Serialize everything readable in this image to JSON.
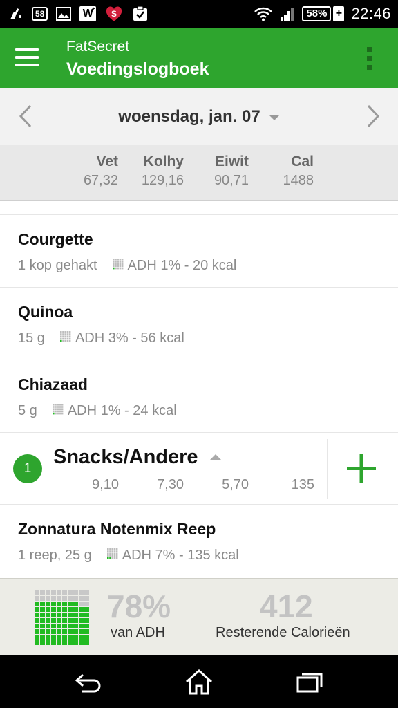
{
  "status_bar": {
    "notification_58": "58",
    "w_icon_text": "W",
    "battery_percent": "58%",
    "charging_symbol": "+",
    "time": "22:46"
  },
  "app_bar": {
    "app_name": "FatSecret",
    "title": "Voedingslogboek"
  },
  "date_nav": {
    "date": "woensdag, jan. 07"
  },
  "totals": {
    "columns": [
      {
        "label": "Vet",
        "value": "67,32"
      },
      {
        "label": "Kolhy",
        "value": "129,16"
      },
      {
        "label": "Eiwit",
        "value": "90,71"
      },
      {
        "label": "Cal",
        "value": "1488"
      }
    ]
  },
  "entries": [
    {
      "name": "Courgette",
      "amount": "1 kop gehakt",
      "rdi": "ADH 1% - 20 kcal"
    },
    {
      "name": "Quinoa",
      "amount": "15 g",
      "rdi": "ADH 3% - 56 kcal"
    },
    {
      "name": "Chiazaad",
      "amount": "5 g",
      "rdi": "ADH 1% - 24 kcal"
    }
  ],
  "meal": {
    "count": "1",
    "name": "Snacks/Andere",
    "values": [
      "9,10",
      "7,30",
      "5,70",
      "135"
    ]
  },
  "meal_entries": [
    {
      "name": "Zonnatura Notenmix Reep",
      "amount": "1 reep, 25 g",
      "rdi": "ADH 7% - 135 kcal"
    }
  ],
  "summary": {
    "rdi_percent": "78%",
    "rdi_label": "van ADH",
    "rdi_fraction": 0.78,
    "remaining_calories": "412",
    "remaining_label": "Resterende Calorieën"
  },
  "colors": {
    "brand_green": "#2ea52e",
    "grid_filled": "#22bb22",
    "grid_empty": "#c8c8c8"
  },
  "icons": {
    "menu": "hamburger-icon",
    "overflow": "overflow-menu-icon",
    "prev": "chevron-left-icon",
    "next": "chevron-right-icon",
    "add": "plus-icon",
    "back": "back-icon",
    "home": "home-icon",
    "recents": "recent-apps-icon"
  }
}
